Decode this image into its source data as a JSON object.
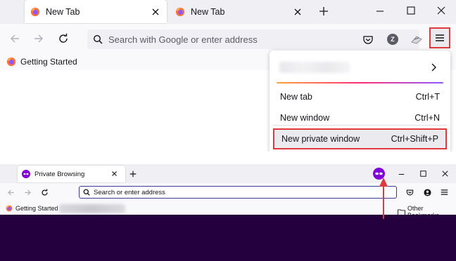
{
  "top_window": {
    "tabs": [
      {
        "label": "New Tab",
        "active": true
      },
      {
        "label": "New Tab",
        "active": false
      }
    ],
    "search": {
      "placeholder": "Search with Google or enter address"
    },
    "account_avatar_letter": "Z",
    "bookmarks": [
      {
        "label": "Getting Started"
      }
    ],
    "app_menu": {
      "items": [
        {
          "label": "New tab",
          "shortcut": "Ctrl+T"
        },
        {
          "label": "New window",
          "shortcut": "Ctrl+N"
        },
        {
          "label": "New private window",
          "shortcut": "Ctrl+Shift+P",
          "highlighted": true
        }
      ]
    }
  },
  "bottom_window": {
    "tab": {
      "label": "Private Browsing"
    },
    "search": {
      "placeholder": "Search or enter address"
    },
    "bookmarks": [
      {
        "label": "Getting Started"
      }
    ],
    "other_bookmarks_label": "Other Bookmarks",
    "content_color": "#25003e"
  },
  "colors": {
    "annotation_red": "#e03a3e",
    "private_purple": "#8000d7"
  }
}
